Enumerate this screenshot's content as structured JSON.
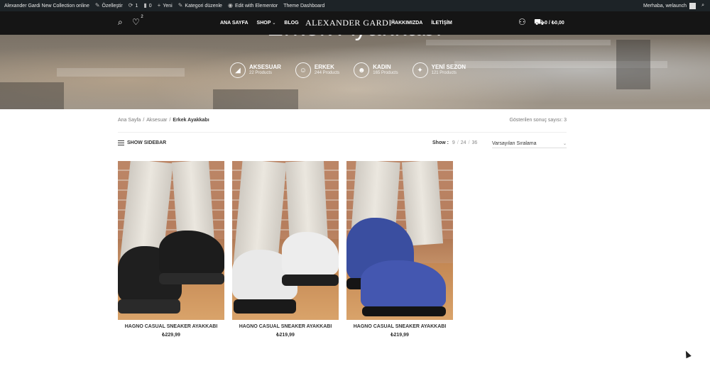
{
  "adminbar": {
    "site_name": "Alexander Gardi New Collection online",
    "customize": "Özelleştir",
    "updates_count": "1",
    "comments_count": "0",
    "new": "Yeni",
    "edit_category": "Kategori düzenle",
    "edit_elementor": "Edit with Elementor",
    "theme_dashboard": "Theme Dashboard",
    "greeting": "Merhaba, welaunch"
  },
  "hero": {
    "title": "Erkek Ayakkabı",
    "categories": [
      {
        "name": "AKSESUAR",
        "count": "22 Products",
        "icon": "shoe-icon"
      },
      {
        "name": "ERKEK",
        "count": "244 Products",
        "icon": "man-icon"
      },
      {
        "name": "KADIN",
        "count": "165 Products",
        "icon": "woman-icon"
      },
      {
        "name": "YENİ SEZON",
        "count": "121 Products",
        "icon": "new-season-icon"
      }
    ]
  },
  "header": {
    "wishlist_count": "2",
    "nav_left": [
      "ANA SAYFA",
      "SHOP",
      "BLOG"
    ],
    "logo": "ALEXANDER GARDI",
    "logo_mark": "®",
    "nav_right": [
      "HAKKIMIZDA",
      "İLETİŞİM"
    ],
    "cart_total": "0 / ₺0,00"
  },
  "breadcrumb": {
    "items": [
      "Ana Sayfa",
      "Aksesuar"
    ],
    "current": "Erkek Ayakkabı",
    "separator": "/"
  },
  "results_text": "Gösterilen sonuç sayısı: 3",
  "toolbar": {
    "show_sidebar": "SHOW SIDEBAR",
    "show_label": "Show :",
    "per_page": [
      "9",
      "24",
      "36"
    ],
    "slash": "/",
    "sort_selected": "Varsayılan Sıralama"
  },
  "products": [
    {
      "name": "HAGNO CASUAL SNEAKER AYAKKABI",
      "price": "₺229,99",
      "shoe_color": "#1f1f1f",
      "sole_color": "#2a2a2a"
    },
    {
      "name": "HAGNO CASUAL SNEAKER AYAKKABI",
      "price": "₺219,99",
      "shoe_color": "#e9e9e9",
      "sole_color": "#1a1a1a"
    },
    {
      "name": "HAGNO CASUAL SNEAKER AYAKKABI",
      "price": "₺219,99",
      "shoe_color": "#3a4ea0",
      "sole_color": "#151515"
    }
  ]
}
